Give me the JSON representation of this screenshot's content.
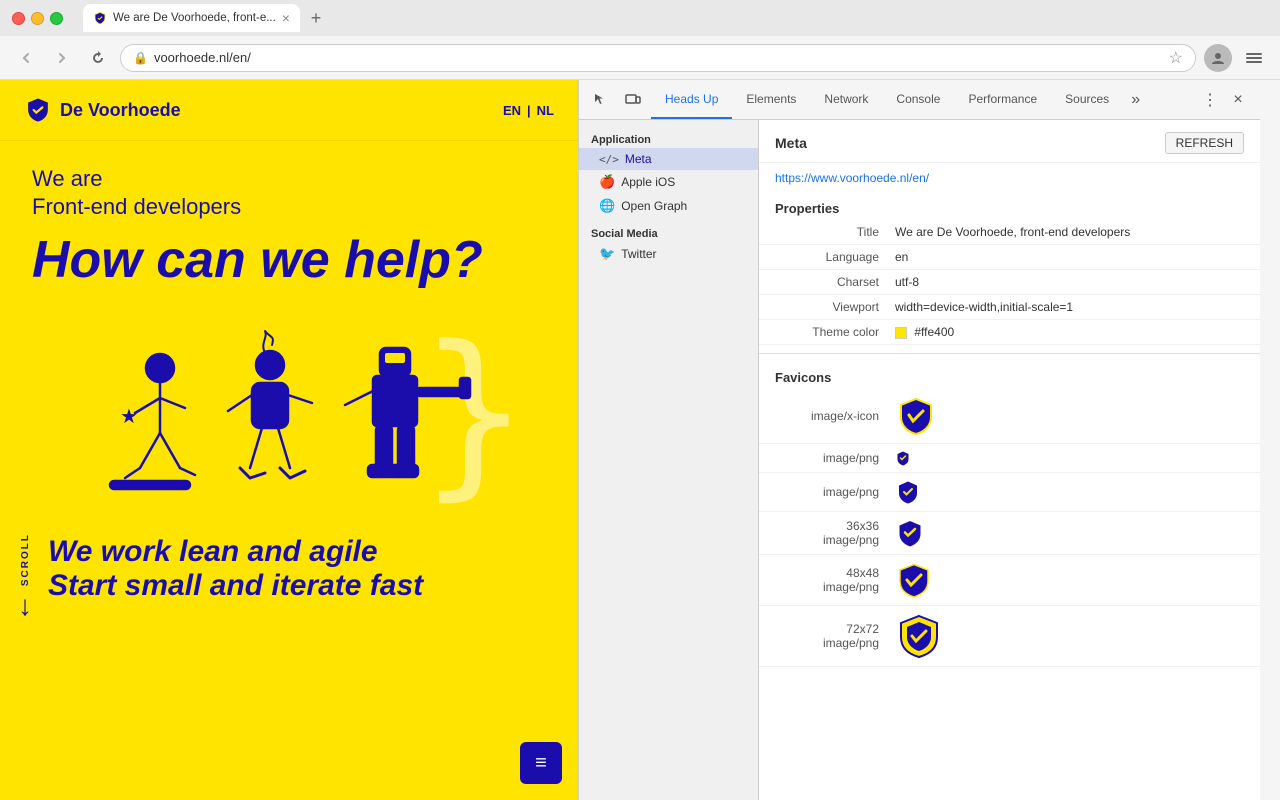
{
  "browser": {
    "tab_title": "We are De Voorhoede, front-e...",
    "tab_favicon": "shield",
    "new_tab_label": "+",
    "address": "voorhoede.nl/en/",
    "back_disabled": true,
    "forward_disabled": true
  },
  "website": {
    "logo_text": "De Voorhoede",
    "lang_en": "EN",
    "lang_sep": "|",
    "lang_nl": "NL",
    "tagline_we_are": "We are",
    "tagline_frontend": "Front-end developers",
    "hero_heading": "How can we help?",
    "scroll_label": "SCROLL",
    "lean_text": "We work lean and agile",
    "iterate_text": "Start small and iterate fast",
    "menu_icon": "≡"
  },
  "devtools": {
    "tabs": [
      {
        "label": "Heads Up",
        "active": true
      },
      {
        "label": "Elements",
        "active": false
      },
      {
        "label": "Network",
        "active": false
      },
      {
        "label": "Console",
        "active": false
      },
      {
        "label": "Performance",
        "active": false
      },
      {
        "label": "Sources",
        "active": false
      }
    ],
    "sidebar": {
      "sections": [
        {
          "label": "Application",
          "items": [
            {
              "label": "Meta",
              "icon": "</>",
              "active": true
            },
            {
              "label": "Apple iOS",
              "icon": "🍎",
              "active": false
            },
            {
              "label": "Open Graph",
              "icon": "🌐",
              "active": false
            }
          ]
        },
        {
          "label": "Social Media",
          "items": [
            {
              "label": "Twitter",
              "icon": "🐦",
              "active": false
            }
          ]
        }
      ]
    },
    "meta": {
      "section_title": "Meta",
      "refresh_label": "REFRESH",
      "url": "https://www.voorhoede.nl/en/",
      "properties_label": "Properties",
      "rows": [
        {
          "key": "Title",
          "value": "We are De Voorhoede, front-end developers"
        },
        {
          "key": "Language",
          "value": "en"
        },
        {
          "key": "Charset",
          "value": "utf-8"
        },
        {
          "key": "Viewport",
          "value": "width=device-width,initial-scale=1"
        },
        {
          "key": "Theme color",
          "value": "#ffe400",
          "has_swatch": true
        }
      ],
      "favicons_label": "Favicons",
      "favicons": [
        {
          "type": "image/x-icon",
          "size": ""
        },
        {
          "type": "image/png",
          "size": ""
        },
        {
          "type": "image/png",
          "size": ""
        },
        {
          "type": "36x36\nimage/png",
          "size": "36x36"
        },
        {
          "type": "48x48\nimage/png",
          "size": "48x48"
        },
        {
          "type": "72x72\nimage/png",
          "size": "72x72"
        }
      ]
    }
  }
}
